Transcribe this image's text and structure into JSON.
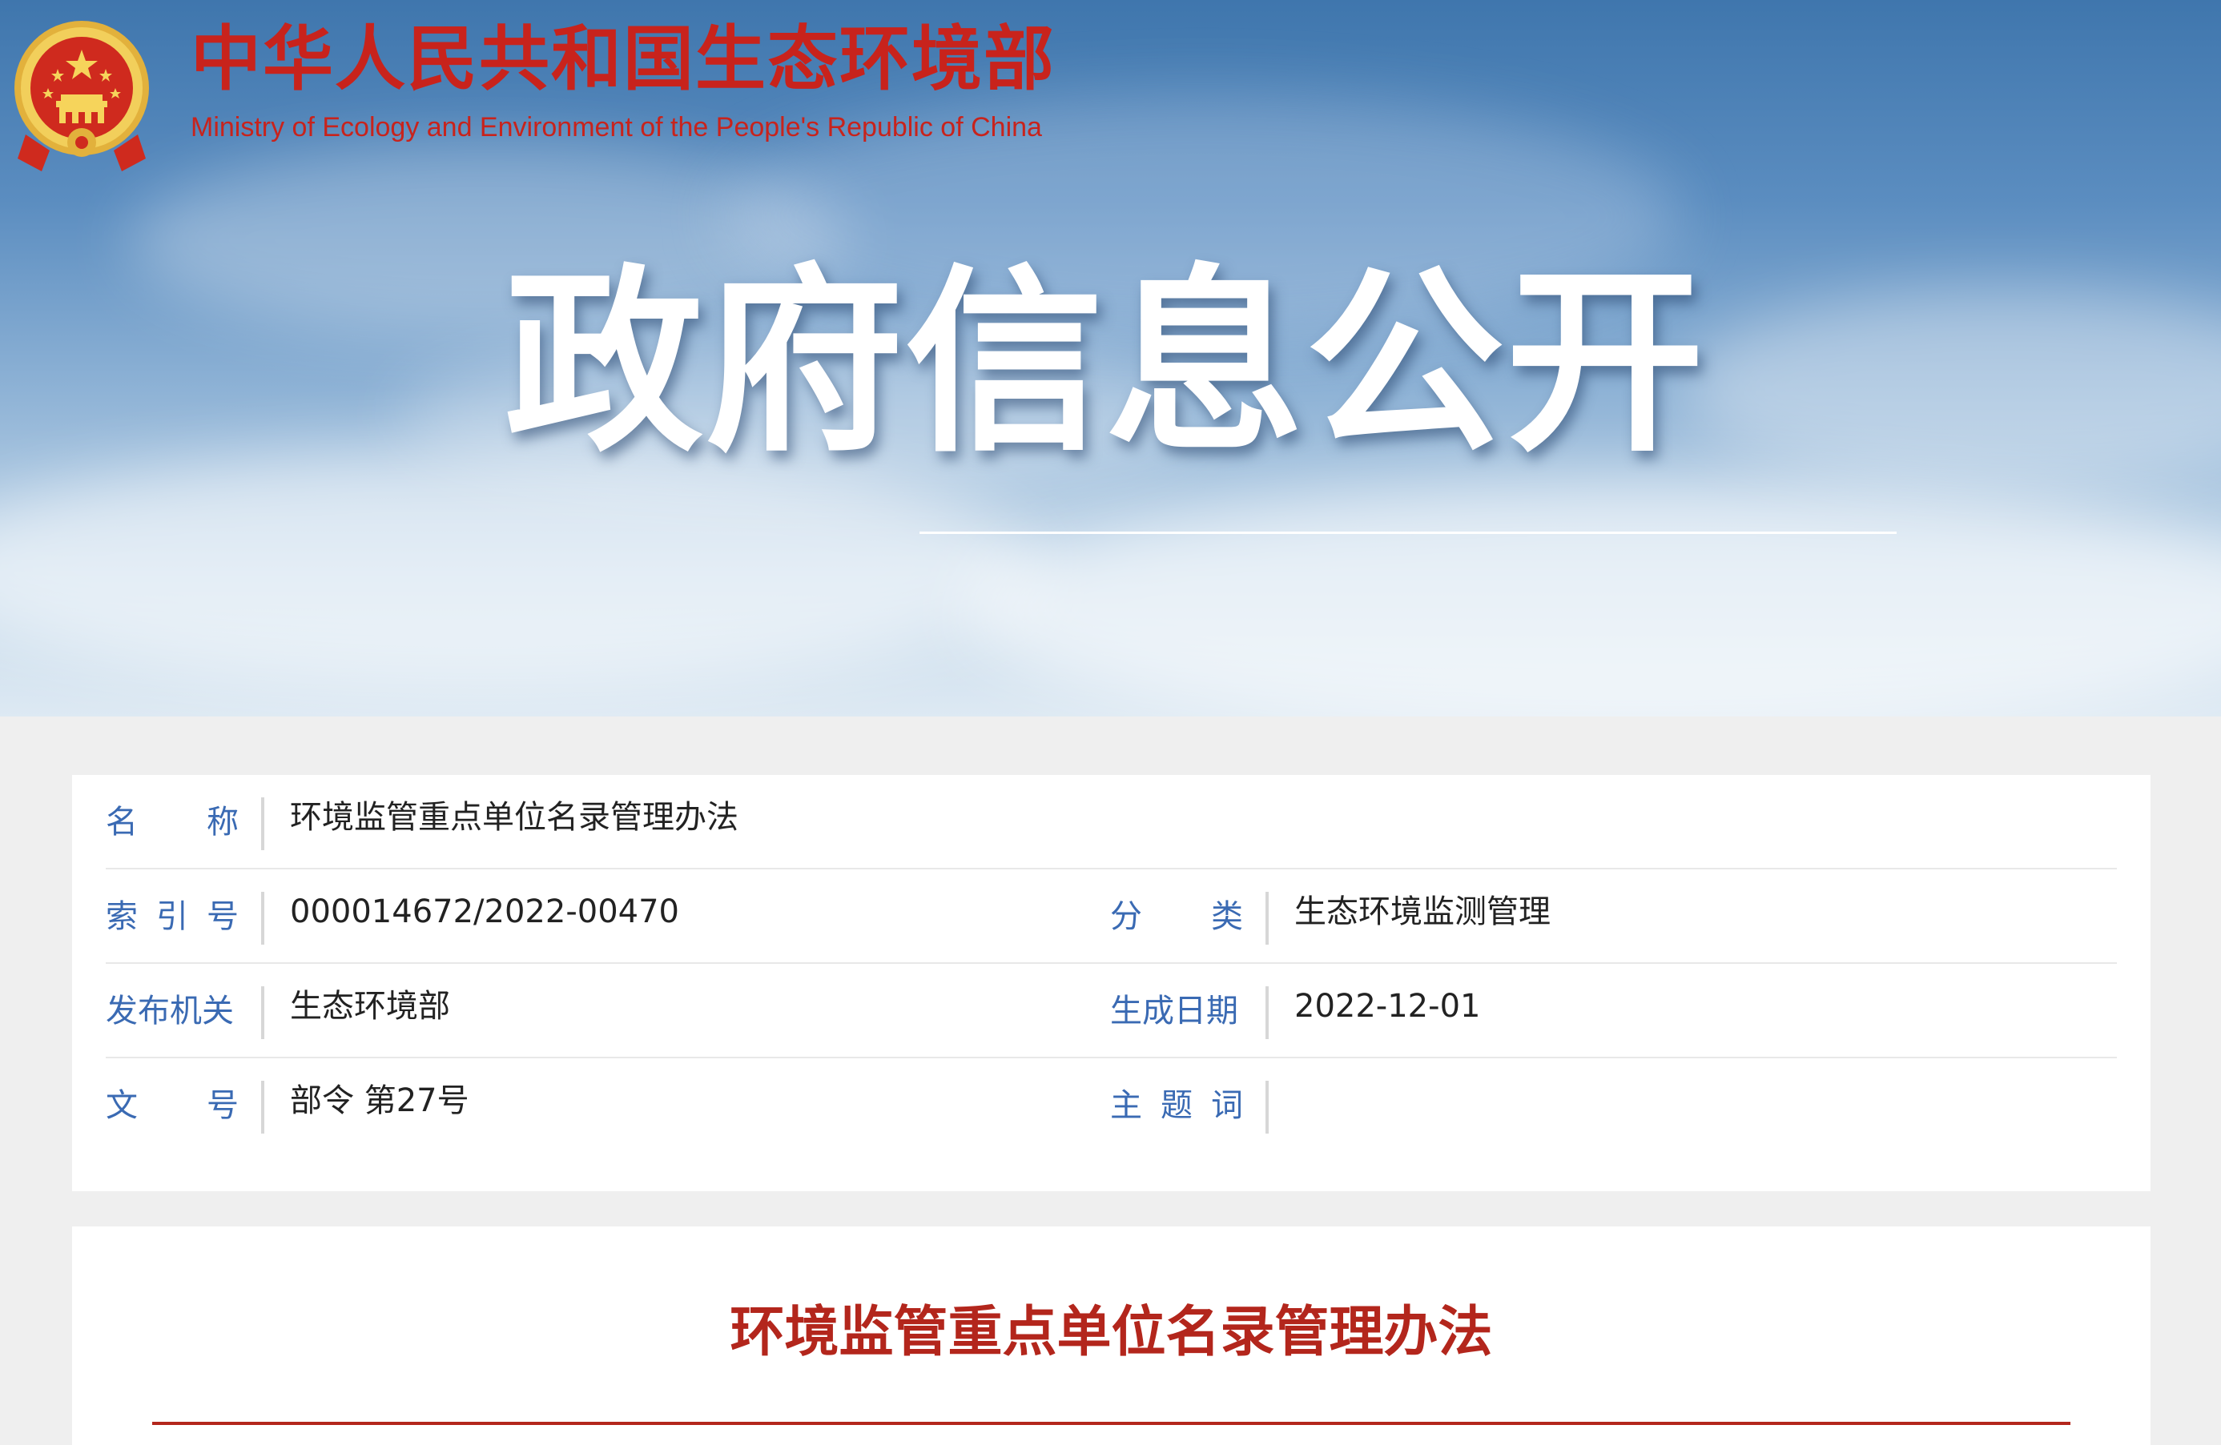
{
  "header": {
    "ministry_cn": "中华人民共和国生态环境部",
    "ministry_en": "Ministry of Ecology and Environment of the People's Republic of China",
    "banner_title": "政府信息公开"
  },
  "meta": {
    "name_label": [
      "名",
      "称"
    ],
    "name_value": "环境监管重点单位名录管理办法",
    "index_label": [
      "索",
      "引",
      "号"
    ],
    "index_value": "000014672/2022-00470",
    "category_label": [
      "分",
      "类"
    ],
    "category_value": "生态环境监测管理",
    "issuer_label": "发布机关",
    "issuer_value": "生态环境部",
    "date_label": "生成日期",
    "date_value": "2022-12-01",
    "docno_label": [
      "文",
      "号"
    ],
    "docno_value": "部令 第27号",
    "keywords_label": [
      "主",
      "题",
      "词"
    ],
    "keywords_value": ""
  },
  "document": {
    "title": "环境监管重点单位名录管理办法"
  },
  "colors": {
    "brand_red": "#c8231c",
    "label_blue": "#3a6ab3",
    "title_red": "#b3261c"
  },
  "icons": {
    "emblem": "national-emblem-icon"
  }
}
